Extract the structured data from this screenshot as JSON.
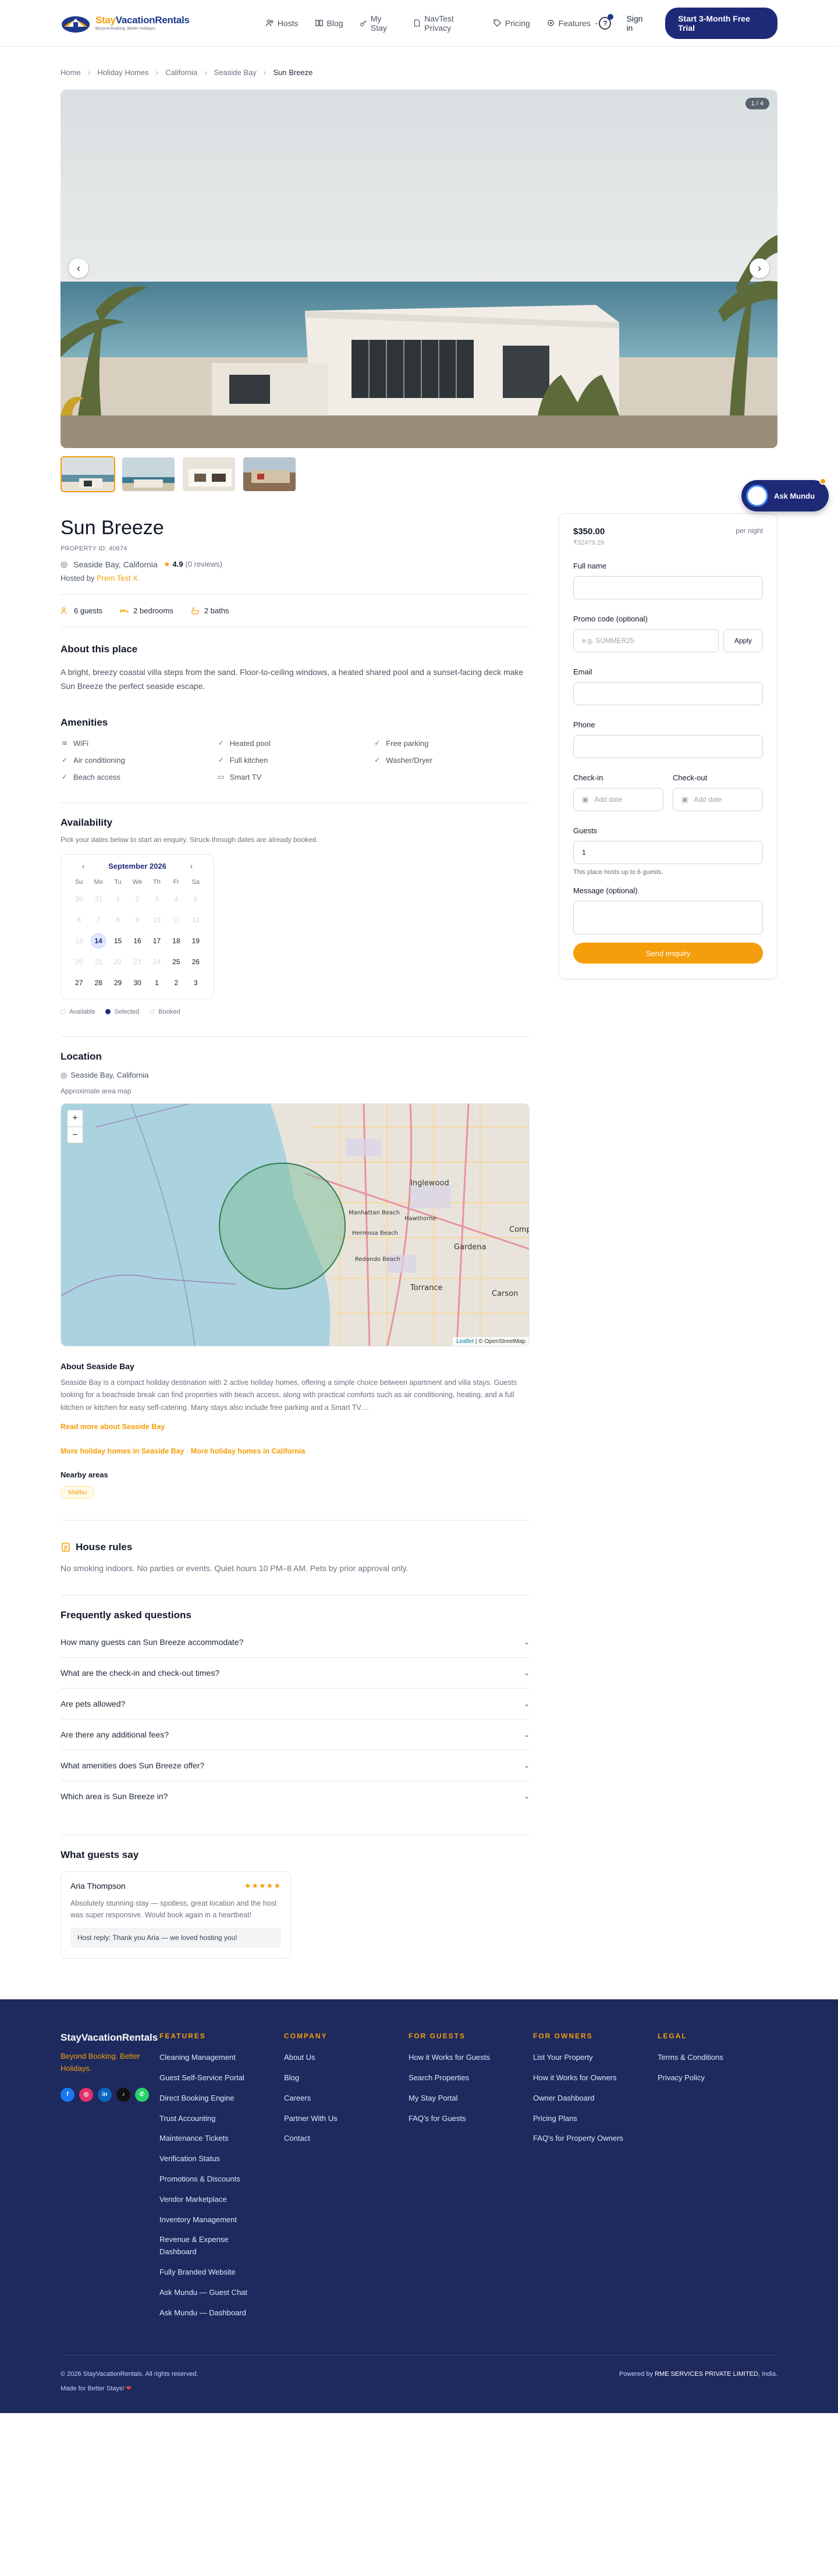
{
  "header": {
    "logo_name_1": "Stay",
    "logo_name_2": "VacationRentals",
    "logo_tagline": "Beyond Booking. Better Holidays.",
    "nav": [
      "Hosts",
      "Blog",
      "My Stay",
      "NavTest Privacy",
      "Pricing",
      "Features"
    ],
    "signin": "Sign in",
    "cta": "Start 3-Month Free Trial"
  },
  "breadcrumb": [
    "Home",
    "Holiday Homes",
    "California",
    "Seaside Bay",
    "Sun Breeze"
  ],
  "gallery": {
    "counter": "1 / 4"
  },
  "property": {
    "title": "Sun Breeze",
    "id_label": "PROPERTY ID: 40674",
    "location": "Seaside Bay, California",
    "rating": "4.9",
    "reviews": "(0 reviews)",
    "hosted_prefix": "Hosted by",
    "host": "Prem Test X",
    "facts": [
      "6 guests",
      "2 bedrooms",
      "2 baths"
    ]
  },
  "about": {
    "heading": "About this place",
    "text": "A bright, breezy coastal villa steps from the sand. Floor-to-ceiling windows, a heated shared pool and a sunset-facing deck make Sun Breeze the perfect seaside escape."
  },
  "amenities": {
    "heading": "Amenities",
    "items": [
      {
        "icon": "wifi-icon",
        "label": "WiFi"
      },
      {
        "icon": "check-icon",
        "label": "Heated pool"
      },
      {
        "icon": "check-icon",
        "label": "Free parking"
      },
      {
        "icon": "check-icon",
        "label": "Air conditioning"
      },
      {
        "icon": "check-icon",
        "label": "Full kitchen"
      },
      {
        "icon": "check-icon",
        "label": "Washer/Dryer"
      },
      {
        "icon": "check-icon",
        "label": "Beach access"
      },
      {
        "icon": "tv-icon",
        "label": "Smart TV"
      }
    ]
  },
  "availability": {
    "heading": "Availability",
    "subtitle": "Pick your dates below to start an enquiry. Struck-through dates are already booked.",
    "month": "September 2026",
    "dow": [
      "Su",
      "Mo",
      "Tu",
      "We",
      "Th",
      "Fr",
      "Sa"
    ],
    "weeks": [
      [
        "30",
        "31",
        "1",
        "2",
        "3",
        "4",
        "5"
      ],
      [
        "6",
        "7",
        "8",
        "9",
        "10",
        "11",
        "12"
      ],
      [
        "13",
        "14",
        "15",
        "16",
        "17",
        "18",
        "19"
      ],
      [
        "20",
        "21",
        "22",
        "23",
        "24",
        "25",
        "26"
      ],
      [
        "27",
        "28",
        "29",
        "30",
        "1",
        "2",
        "3"
      ]
    ],
    "legend": [
      "Available",
      "Selected",
      "Booked"
    ]
  },
  "location": {
    "heading": "Location",
    "place": "Seaside Bay, California",
    "approx": "Approximate area map",
    "map_labels": {
      "inglewood": "Inglewood",
      "hawthorne": "Hawthorne",
      "gardena": "Gardena",
      "torrance": "Torrance",
      "carson": "Carson",
      "redondo": "Redondo Beach",
      "hermosa": "Hermosa Beach",
      "manhattan": "Manhattan Beach",
      "compton": "Comp"
    },
    "attribution_1": "Leaflet",
    "attribution_2": "| © OpenStreetMap"
  },
  "area": {
    "heading": "About Seaside Bay",
    "text": "Seaside Bay is a compact holiday destination with 2 active holiday homes, offering a simple choice between apartment and villa stays. Guests looking for a beachside break can find properties with beach access, along with practical comforts such as air conditioning, heating, and a full kitchen or kitchen for easy self-catering. Many stays also include free parking and a Smart TV....",
    "read_more": "Read more about Seaside Bay",
    "link_1": "More holiday homes in Seaside Bay",
    "link_sep": "·",
    "link_2": "More holiday homes in California",
    "nearby_heading": "Nearby areas",
    "nearby": [
      "Malibu"
    ]
  },
  "rules": {
    "heading": "House rules",
    "text": "No smoking indoors. No parties or events. Quiet hours 10 PM–8 AM. Pets by prior approval only."
  },
  "faq": {
    "heading": "Frequently asked questions",
    "items": [
      "How many guests can Sun Breeze accommodate?",
      "What are the check-in and check-out times?",
      "Are pets allowed?",
      "Are there any additional fees?",
      "What amenities does Sun Breeze offer?",
      "Which area is Sun Breeze in?"
    ]
  },
  "reviews": {
    "heading": "What guests say",
    "items": [
      {
        "name": "Aria Thompson",
        "stars": "★★★★★",
        "text": "Absolutely stunning stay — spotless, great location and the host was super responsive. Would book again in a heartbeat!",
        "reply": "Host reply: Thank you Aria — we loved hosting you!"
      }
    ]
  },
  "booking": {
    "price": "$350.00",
    "per": "per night",
    "converted": "₹32479.29",
    "full_name": "Full name",
    "promo_label": "Promo code (optional)",
    "promo_placeholder": "e.g. SUMMER25",
    "apply": "Apply",
    "email": "Email",
    "phone": "Phone",
    "checkin": "Check-in",
    "checkout": "Check-out",
    "date_placeholder": "Add date",
    "guests_label": "Guests",
    "guests_value": "1",
    "guests_hint": "This place hosts up to 6 guests.",
    "message_label": "Message (optional)",
    "send": "Send enquiry"
  },
  "ask": {
    "label": "Ask Mundu"
  },
  "footer": {
    "brand": "StayVacationRentals",
    "slogan": "Beyond Booking. Better Holidays.",
    "socials": [
      {
        "icon": "facebook-icon",
        "glyph": "f",
        "color": "#1877f2"
      },
      {
        "icon": "instagram-icon",
        "glyph": "◎",
        "color": "#e1306c"
      },
      {
        "icon": "linkedin-icon",
        "glyph": "in",
        "color": "#0a66c2"
      },
      {
        "icon": "tiktok-icon",
        "glyph": "♪",
        "color": "#111111"
      },
      {
        "icon": "whatsapp-icon",
        "glyph": "✆",
        "color": "#25d366"
      }
    ],
    "columns": [
      {
        "title": "FEATURES",
        "links": [
          "Cleaning Management",
          "Guest Self-Service Portal",
          "Direct Booking Engine",
          "Trust Accounting",
          "Maintenance Tickets",
          "Verification Status",
          "Promotions & Discounts",
          "Vendor Marketplace",
          "Inventory Management",
          "Revenue & Expense Dashboard",
          "Fully Branded Website",
          "Ask Mundu — Guest Chat",
          "Ask Mundu — Dashboard"
        ]
      },
      {
        "title": "COMPANY",
        "links": [
          "About Us",
          "Blog",
          "Careers",
          "Partner With Us",
          "Contact"
        ]
      },
      {
        "title": "FOR GUESTS",
        "links": [
          "How it Works for Guests",
          "Search Properties",
          "My Stay Portal",
          "FAQ's for Guests"
        ]
      },
      {
        "title": "FOR OWNERS",
        "links": [
          "List Your Property",
          "How it Works for Owners",
          "Owner Dashboard",
          "Pricing Plans",
          "FAQ's for Property Owners"
        ]
      },
      {
        "title": "LEGAL",
        "links": [
          "Terms & Conditions",
          "Privacy Policy"
        ]
      }
    ],
    "copyright": "© 2026 StayVacationRentals. All rights reserved.",
    "made": "Made for Better Stays!",
    "powered_prefix": "Powered by",
    "powered_by": "RME SERVICES PRIVATE LIMITED",
    "powered_suffix": ", India."
  }
}
